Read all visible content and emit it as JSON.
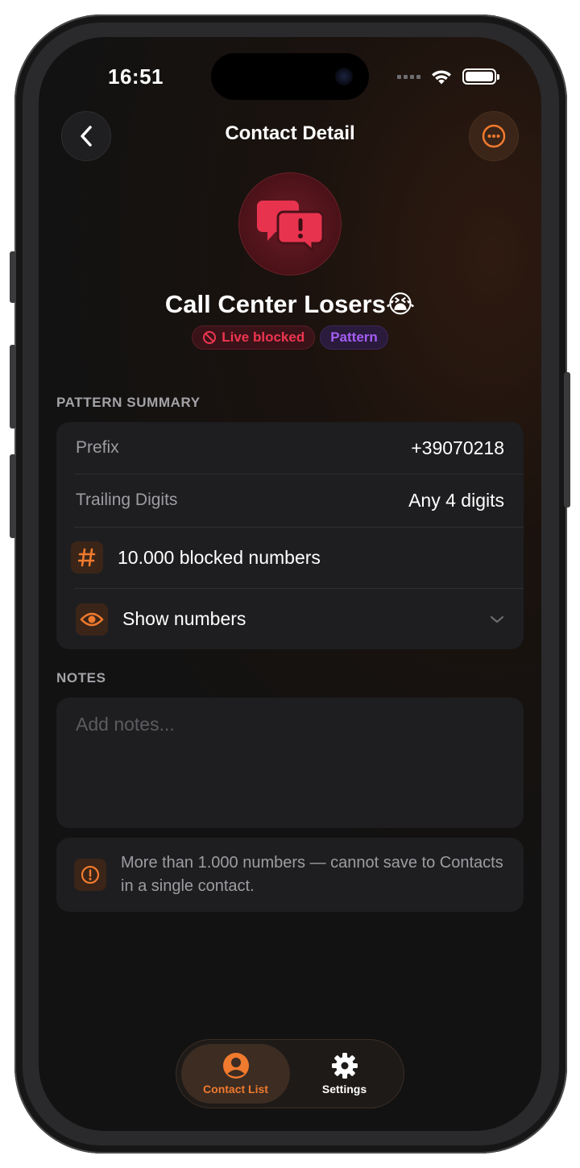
{
  "status_bar": {
    "time": "16:51"
  },
  "nav": {
    "title": "Contact Detail"
  },
  "contact": {
    "name": "Call Center Losers😭",
    "badges": {
      "blocked": "Live blocked",
      "pattern": "Pattern"
    }
  },
  "pattern_summary": {
    "section_label": "PATTERN SUMMARY",
    "prefix_label": "Prefix",
    "prefix_value": "+39070218",
    "trailing_label": "Trailing Digits",
    "trailing_value": "Any 4 digits",
    "blocked_count_text": "10.000 blocked numbers",
    "show_numbers_label": "Show numbers"
  },
  "notes": {
    "section_label": "NOTES",
    "placeholder": "Add notes...",
    "value": ""
  },
  "warning": {
    "text": "More than 1.000 numbers — cannot save to Contacts in a single contact."
  },
  "tabbar": {
    "tabs": [
      {
        "label": "Contact List",
        "icon": "person-circle-icon",
        "active": true
      },
      {
        "label": "Settings",
        "icon": "gear-icon",
        "active": false
      }
    ]
  },
  "colors": {
    "accent": "#f07a2e",
    "blocked_red": "#ef3550",
    "pattern_purple": "#a45ef2",
    "avatar_red": "#e8334f",
    "card_bg": "#1e1e20"
  }
}
